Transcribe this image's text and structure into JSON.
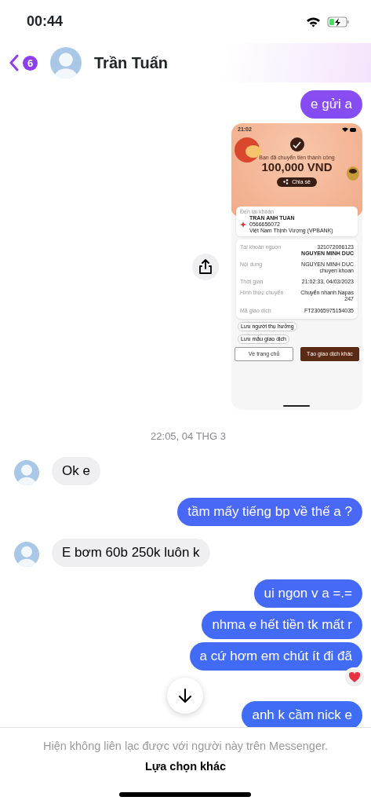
{
  "status_bar": {
    "time": "00:44"
  },
  "header": {
    "unread_count": "6",
    "contact_name": "Trần Tuấn"
  },
  "messages": [
    {
      "kind": "sent",
      "text": "e gửi a"
    },
    {
      "kind": "sent_image",
      "screenshot": {
        "time": "21:02",
        "success_text": "Bạn đã chuyển tiền thành công",
        "amount": "100,000 VND",
        "share": "Chia sẻ",
        "recipient_label": "Đến tài khoản",
        "recipient_name": "TRAN ANH TUAN",
        "recipient_account": "0566656072",
        "recipient_bank": "Việt Nam Thịnh Vượng (VPBANK)",
        "details": [
          {
            "label": "Tài khoản nguồn",
            "lines": [
              "321072006123",
              "**NGUYEN MINH DUC**"
            ]
          },
          {
            "label": "Nội dung",
            "lines": [
              "NGUYEN MINH DUC",
              "chuyen khoan"
            ]
          },
          {
            "label": "Thời gian",
            "lines": [
              "21:02:33, 04/03/2023"
            ]
          },
          {
            "label": "Hình thức chuyển",
            "lines": [
              "Chuyển nhanh Napas",
              "247"
            ]
          },
          {
            "label": "Mã giao dịch",
            "lines": [
              "FT23065975154035"
            ]
          }
        ],
        "save_buttons": [
          "Lưu người thụ hưởng",
          "Lưu mẫu giao dịch"
        ],
        "home_button": "Về trang chủ",
        "new_button": "Tạo giao dịch khác"
      }
    },
    {
      "kind": "timestamp",
      "text": "22:05, 04 THG 3"
    },
    {
      "kind": "received",
      "text": "Ok e"
    },
    {
      "kind": "sent",
      "text": "tầm mấy tiếng bp về thế a ?"
    },
    {
      "kind": "received",
      "text": "E bơm 60b 250k luôn k"
    },
    {
      "kind": "sent",
      "text": "ui ngon v a =.="
    },
    {
      "kind": "sent",
      "text": "nhma e hết tiền tk mất r"
    },
    {
      "kind": "sent",
      "text": "a cứ hơm em chút ít đi đã",
      "reacted": true
    },
    {
      "kind": "sent",
      "text": "anh k cầm nick e"
    }
  ],
  "footer": {
    "notice": "Hiện không liên lạc được với người này trên Messenger.",
    "action": "Lựa chọn khác"
  }
}
